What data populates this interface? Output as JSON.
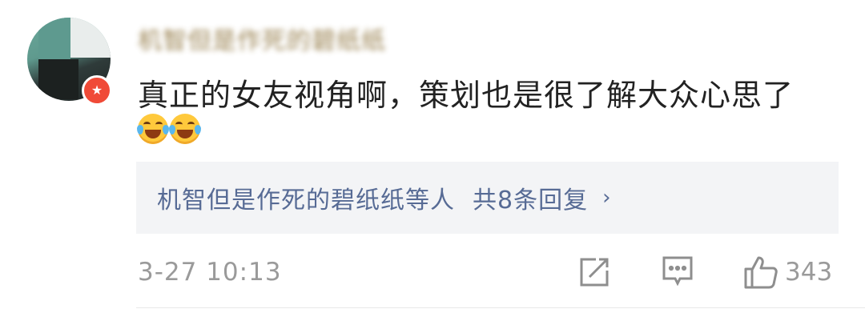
{
  "comment": {
    "username": "机智但是作死的碧纸纸",
    "text": "真正的女友视角啊，策划也是很了解大众心思了",
    "emojis": [
      "laugh-cry-emoji",
      "laugh-cry-emoji"
    ],
    "badge_icon": "verified-star-icon",
    "badge_color": "#f04a37"
  },
  "replies": {
    "users": "机智但是作死的碧纸纸等人",
    "count_label": "共8条回复",
    "chevron": "›",
    "link_color": "#576b95"
  },
  "footer": {
    "timestamp": "3-27 10:13",
    "like_count": "343"
  }
}
